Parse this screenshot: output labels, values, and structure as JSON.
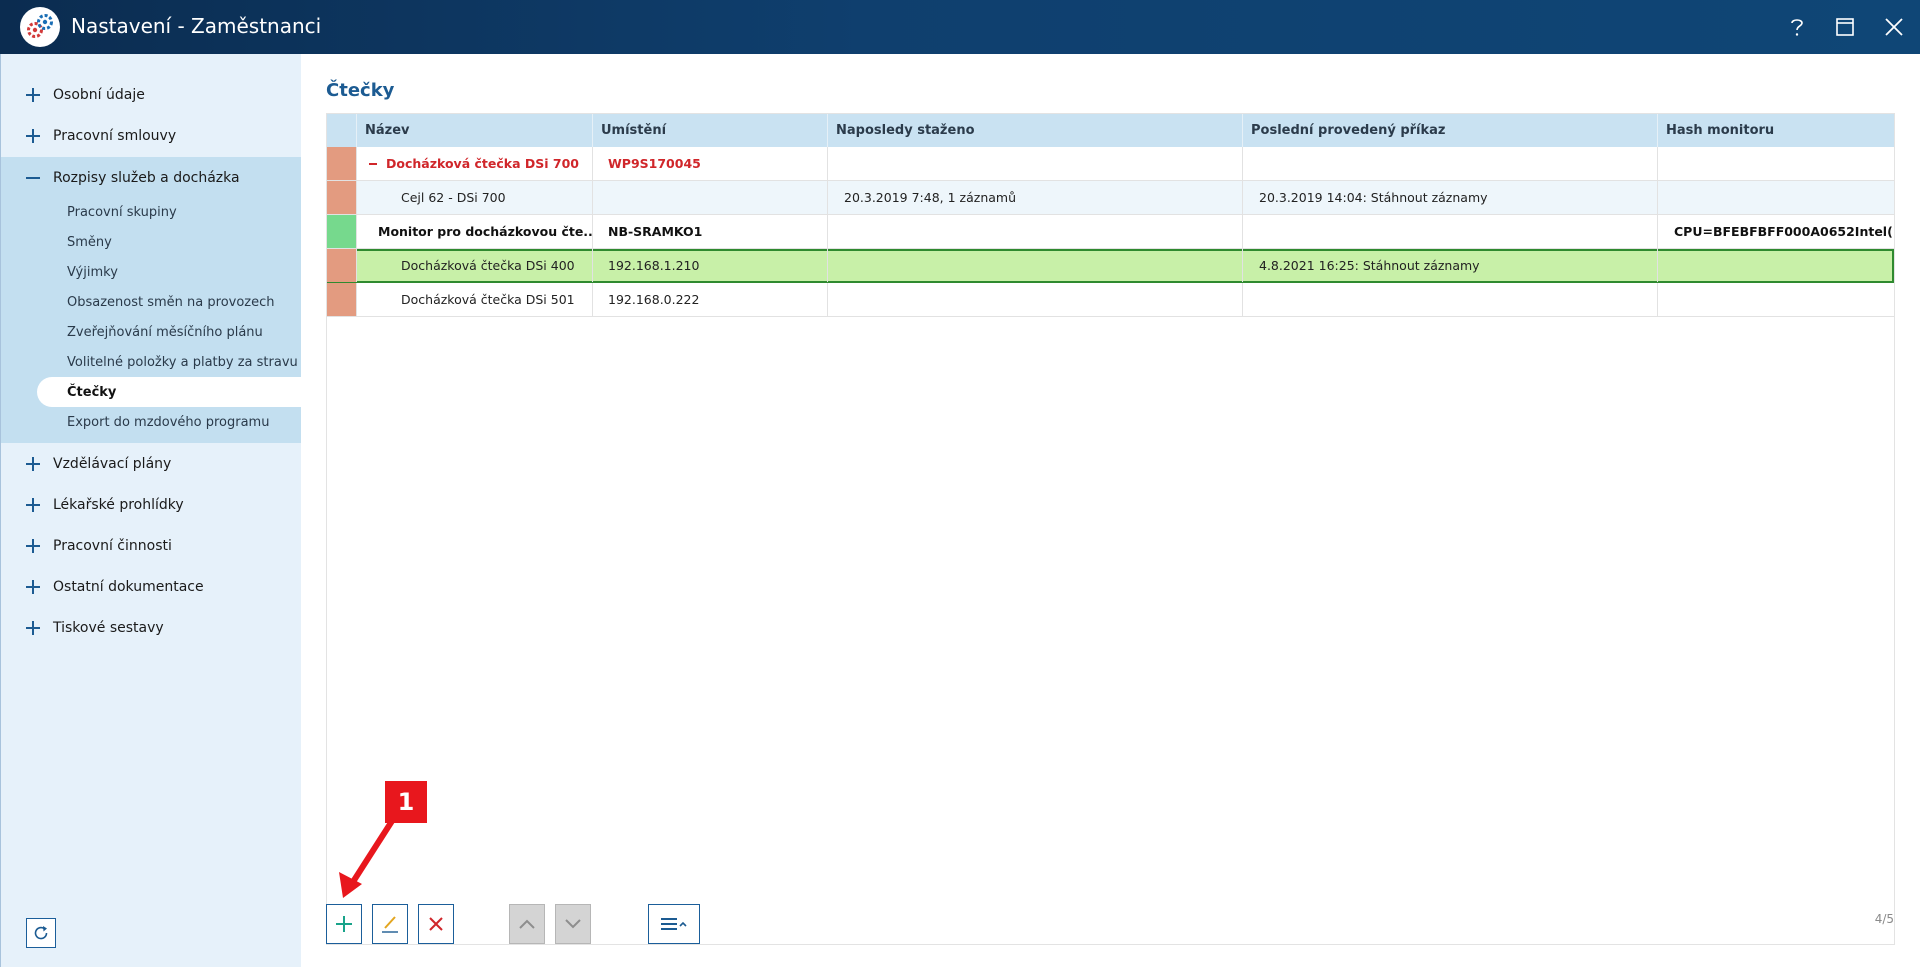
{
  "window": {
    "title": "Nastavení - Zaměstnanci"
  },
  "sidebar": {
    "top_items": [
      {
        "label": "Osobní údaje"
      },
      {
        "label": "Pracovní smlouvy"
      },
      {
        "label": "Rozpisy služeb a docházka"
      }
    ],
    "sub_items": [
      {
        "label": "Pracovní skupiny"
      },
      {
        "label": "Směny"
      },
      {
        "label": "Výjimky"
      },
      {
        "label": "Obsazenost směn na provozech"
      },
      {
        "label": "Zveřejňování měsíčního plánu"
      },
      {
        "label": "Volitelné položky a platby za stravu"
      },
      {
        "label": "Čtečky"
      },
      {
        "label": "Export do mzdového programu"
      }
    ],
    "bottom_items": [
      {
        "label": "Vzdělávací plány"
      },
      {
        "label": "Lékařské prohlídky"
      },
      {
        "label": "Pracovní činnosti"
      },
      {
        "label": "Ostatní dokumentace"
      },
      {
        "label": "Tiskové sestavy"
      }
    ]
  },
  "main": {
    "title": "Čtečky",
    "columns": [
      "Název",
      "Umístění",
      "Naposledy staženo",
      "Poslední provedený příkaz",
      "Hash monitoru"
    ],
    "rows": [
      {
        "name": "Docházková čtečka DSi 700",
        "location": "WP9S170045",
        "last_download": "",
        "last_command": "",
        "hash": ""
      },
      {
        "name": "Cejl 62 - DSi 700",
        "location": "",
        "last_download": "20.3.2019 7:48, 1 záznamů",
        "last_command": "20.3.2019 14:04: Stáhnout záznamy",
        "hash": ""
      },
      {
        "name": "Monitor pro docházkovou čte...",
        "location": "NB-SRAMKO1",
        "last_download": "",
        "last_command": "",
        "hash": "CPU=BFEBFBFF000A0652Intel(..."
      },
      {
        "name": "Docházková čtečka DSi 400",
        "location": "192.168.1.210",
        "last_download": "",
        "last_command": "4.8.2021 16:25: Stáhnout záznamy",
        "hash": ""
      },
      {
        "name": "Docházková čtečka DSi 501",
        "location": "192.168.0.222",
        "last_download": "",
        "last_command": "",
        "hash": ""
      }
    ],
    "pager": "4/5"
  },
  "annotation": {
    "number": "1"
  },
  "colors": {
    "accent": "#1c5b92",
    "selected_row": "#c8f0a8",
    "status_orange": "#e39b80",
    "status_green": "#76d98d",
    "marker_red": "#e8171d"
  }
}
